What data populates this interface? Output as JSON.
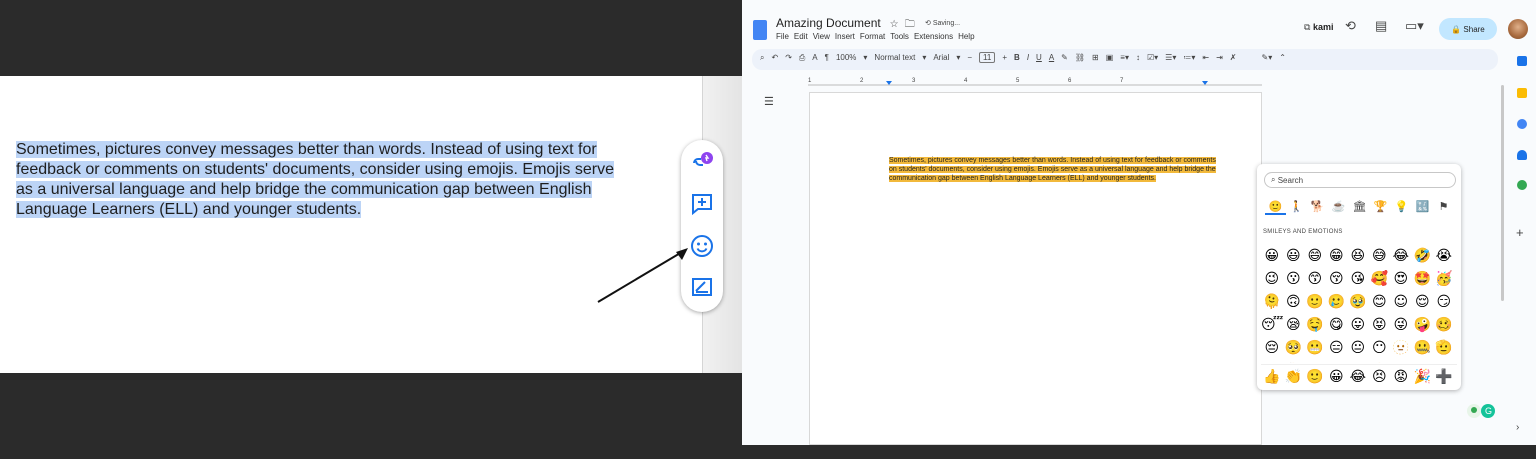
{
  "left": {
    "paragraph": "Sometimes, pictures convey messages better than words. Instead of using text for feedback or comments on students' documents, consider using emojis. Emojis serve as a universal language and help bridge the communication gap between English Language Learners (ELL) and younger students."
  },
  "docs": {
    "title": "Amazing Document",
    "saving": "Saving...",
    "menu": [
      "File",
      "Edit",
      "View",
      "Insert",
      "Format",
      "Tools",
      "Extensions",
      "Help"
    ],
    "kami": "kami",
    "share": "Share",
    "toolbar": {
      "zoom": "100%",
      "style": "Normal text",
      "font": "Arial",
      "size": "11"
    },
    "ruler": [
      "1",
      "2",
      "3",
      "4",
      "5",
      "6",
      "7"
    ],
    "body_text": "Sometimes, pictures convey messages better than words. Instead of using text for feedback or comments on students' documents, consider using emojis. Emojis serve as a universal language and help bridge the communication gap between English Language Learners (ELL) and younger students.",
    "emoji_picker": {
      "search_placeholder": "Search",
      "section": "SMILEYS AND EMOTIONS",
      "categories": [
        "🙂",
        "🚶",
        "🐕",
        "☕",
        "🏛",
        "🏆",
        "💡",
        "🔣",
        "⚑"
      ],
      "grid": [
        [
          "😀",
          "😃",
          "😄",
          "😁",
          "😆",
          "😅",
          "😂",
          "🤣",
          "😭"
        ],
        [
          "😉",
          "😗",
          "😙",
          "😚",
          "😘",
          "🥰",
          "😍",
          "🤩",
          "🥳"
        ],
        [
          "🫠",
          "🙃",
          "🙂",
          "🥲",
          "🥹",
          "😊",
          "☺",
          "😌",
          "😏"
        ],
        [
          "😴",
          "😪",
          "🤤",
          "😋",
          "😛",
          "😝",
          "😜",
          "🤪",
          "🥴"
        ],
        [
          "😔",
          "🥺",
          "😬",
          "😑",
          "😐",
          "😶",
          "🫥",
          "🤐",
          "🫡"
        ],
        [
          "😮",
          "🤔",
          "😯",
          "😲",
          "😳",
          "🥱",
          "😮",
          "😦",
          "😧"
        ]
      ],
      "quick": [
        "👍",
        "👏",
        "🙂",
        "😀",
        "😂",
        "😣",
        "😡",
        "🎉",
        "➕"
      ]
    }
  },
  "colors": {
    "highlight_blue": "#bcd4f6",
    "highlight_orange": "#f2b93b",
    "share_bg": "#c2e7ff",
    "accent": "#1a73e8"
  }
}
